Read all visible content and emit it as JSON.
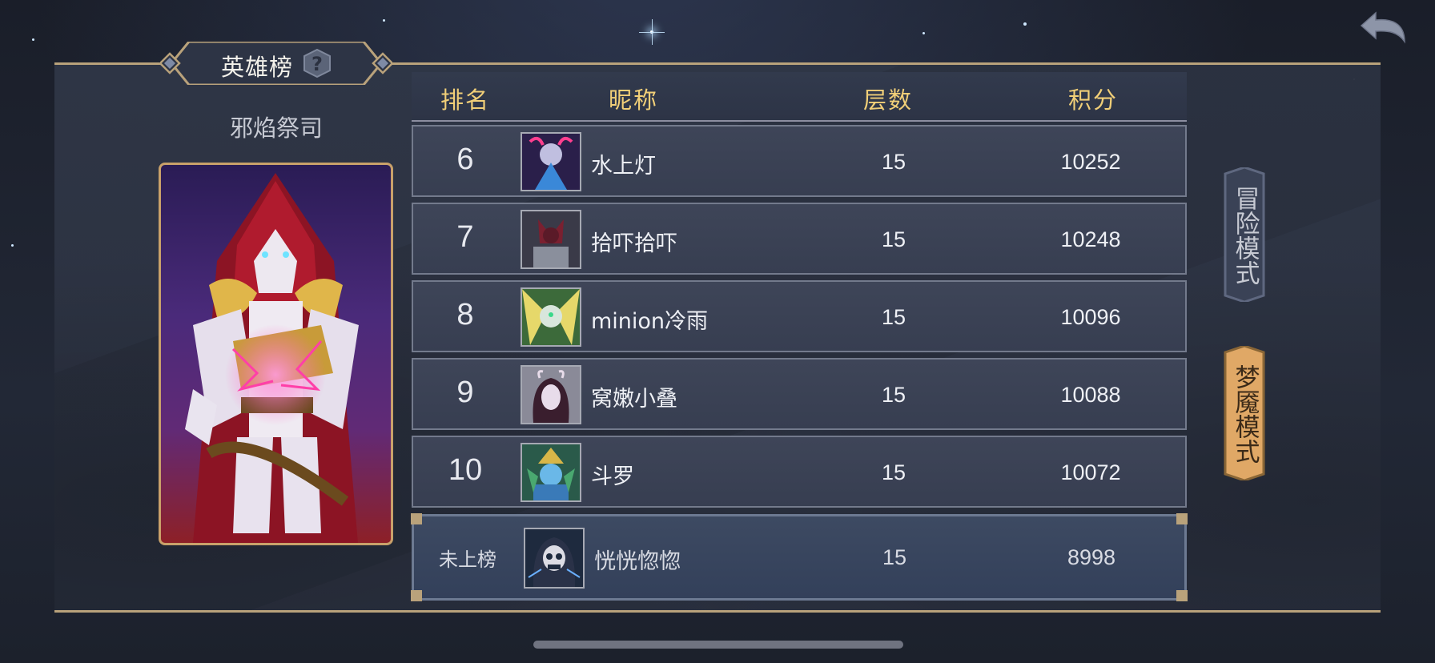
{
  "header": {
    "title": "英雄榜"
  },
  "hero": {
    "name": "邪焰祭司"
  },
  "table": {
    "columns": {
      "rank": "排名",
      "nickname": "昵称",
      "floors": "层数",
      "score": "积分"
    },
    "rows": [
      {
        "rank": "6",
        "nickname": "水上灯",
        "floors": "15",
        "score": "10252"
      },
      {
        "rank": "7",
        "nickname": "拾吓拾吓",
        "floors": "15",
        "score": "10248"
      },
      {
        "rank": "8",
        "nickname": "minion冷雨",
        "floors": "15",
        "score": "10096"
      },
      {
        "rank": "9",
        "nickname": "窝嫩小叠",
        "floors": "15",
        "score": "10088"
      },
      {
        "rank": "10",
        "nickname": "斗罗",
        "floors": "15",
        "score": "10072"
      }
    ],
    "self": {
      "rank": "未上榜",
      "nickname": "恍恍惚惚",
      "floors": "15",
      "score": "8998"
    }
  },
  "modes": {
    "adventure": "冒险模式",
    "nightmare": "梦魇模式",
    "selected": "nightmare"
  },
  "colors": {
    "header_text": "#f1cf78",
    "frame_gold": "#b9a27b",
    "nightmare_selected": "#e0a866",
    "panel_bg": "#2f3646"
  },
  "icons": {
    "back": "back-arrow-icon",
    "help": "question-mark-icon"
  }
}
